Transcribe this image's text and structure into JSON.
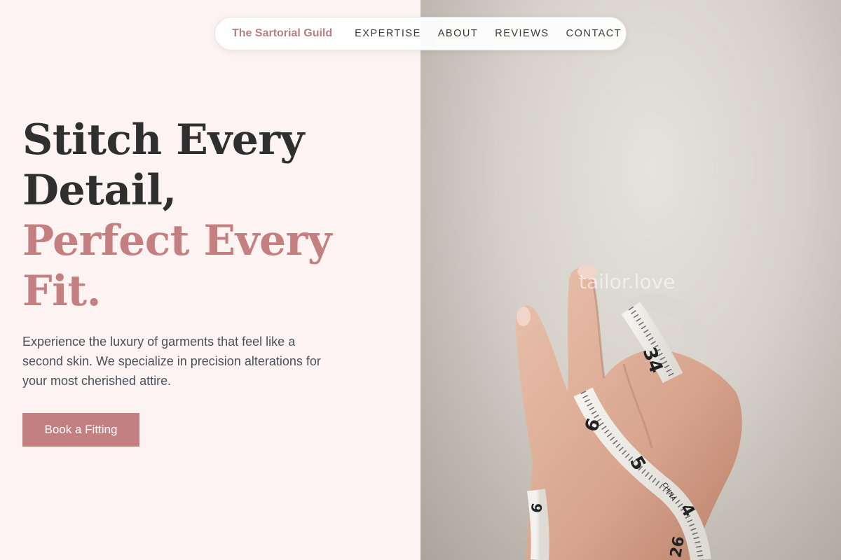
{
  "nav": {
    "brand": "The Sartorial Guild",
    "links": [
      "EXPERTISE",
      "ABOUT",
      "REVIEWS",
      "CONTACT"
    ]
  },
  "hero": {
    "headline_line1": "Stitch Every",
    "headline_line2": "Detail,",
    "headline_line3": "Perfect Every",
    "headline_line4": "Fit.",
    "description": "Experience the luxury of garments that feel like a second skin. We specialize in precision alterations for your most cherished attire.",
    "cta_label": "Book a Fitting"
  },
  "image": {
    "subject": "hand holding a measuring tape",
    "watermark": "tailor.love",
    "tape_numbers": [
      "34",
      "6",
      "5",
      "4",
      "26",
      "6"
    ],
    "tape_brand": "CHINA"
  },
  "colors": {
    "background": "#fdf3f3",
    "accent": "#c47f80",
    "brand": "#b87f80",
    "headline_dark": "#2f2f2f",
    "body_text": "#4b4f58"
  }
}
